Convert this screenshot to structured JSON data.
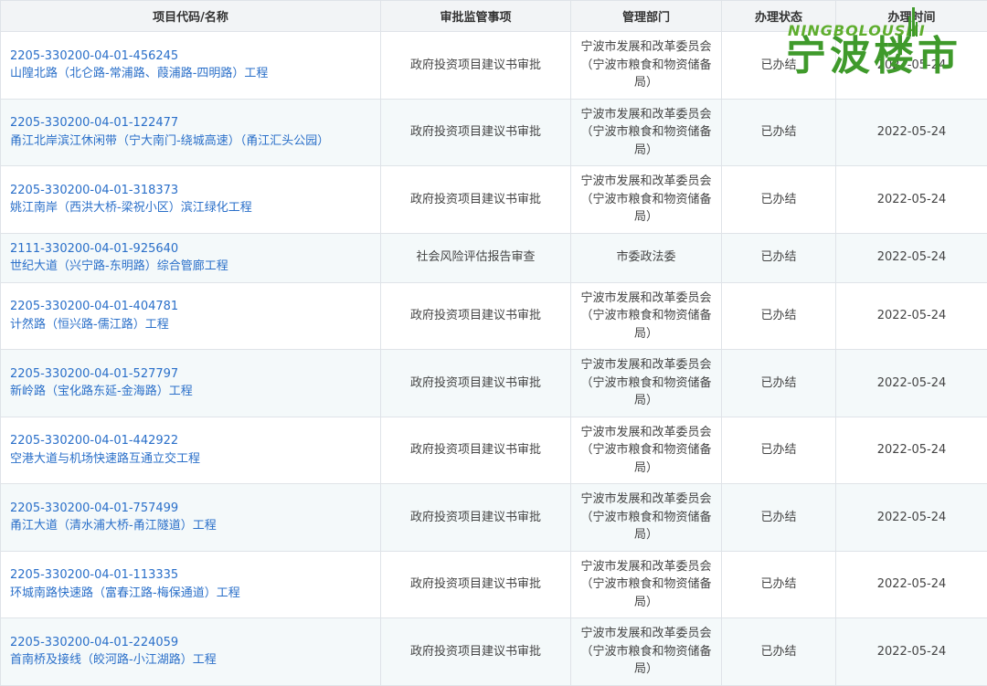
{
  "table": {
    "headers": [
      "项目代码/名称",
      "审批监管事项",
      "管理部门",
      "办理状态",
      "办理时间"
    ],
    "rows": [
      {
        "code": "2205-330200-04-01-456245",
        "name": "山隍北路（北仑路-常浦路、葭浦路-四明路）工程",
        "matter": "政府投资项目建议书审批",
        "dept": [
          "宁波市发展和改革委员会",
          "（宁波市粮食和物资储备",
          "局）"
        ],
        "status": "已办结",
        "date": "2022-05-24"
      },
      {
        "code": "2205-330200-04-01-122477",
        "name": "甬江北岸滨江休闲带（宁大南门-绕城高速）（甬江汇头公园）",
        "matter": "政府投资项目建议书审批",
        "dept": [
          "宁波市发展和改革委员会",
          "（宁波市粮食和物资储备",
          "局）"
        ],
        "status": "已办结",
        "date": "2022-05-24"
      },
      {
        "code": "2205-330200-04-01-318373",
        "name": "姚江南岸（西洪大桥-梁祝小区）滨江绿化工程",
        "matter": "政府投资项目建议书审批",
        "dept": [
          "宁波市发展和改革委员会",
          "（宁波市粮食和物资储备",
          "局）"
        ],
        "status": "已办结",
        "date": "2022-05-24"
      },
      {
        "code": "2111-330200-04-01-925640",
        "name": "世纪大道（兴宁路-东明路）综合管廊工程",
        "matter": "社会风险评估报告审查",
        "dept": [
          "市委政法委"
        ],
        "status": "已办结",
        "date": "2022-05-24"
      },
      {
        "code": "2205-330200-04-01-404781",
        "name": "计然路（恒兴路-儒江路）工程",
        "matter": "政府投资项目建议书审批",
        "dept": [
          "宁波市发展和改革委员会",
          "（宁波市粮食和物资储备",
          "局）"
        ],
        "status": "已办结",
        "date": "2022-05-24"
      },
      {
        "code": "2205-330200-04-01-527797",
        "name": "新岭路（宝化路东延-金海路）工程",
        "matter": "政府投资项目建议书审批",
        "dept": [
          "宁波市发展和改革委员会",
          "（宁波市粮食和物资储备",
          "局）"
        ],
        "status": "已办结",
        "date": "2022-05-24"
      },
      {
        "code": "2205-330200-04-01-442922",
        "name": "空港大道与机场快速路互通立交工程",
        "matter": "政府投资项目建议书审批",
        "dept": [
          "宁波市发展和改革委员会",
          "（宁波市粮食和物资储备",
          "局）"
        ],
        "status": "已办结",
        "date": "2022-05-24"
      },
      {
        "code": "2205-330200-04-01-757499",
        "name": "甬江大道（清水浦大桥-甬江隧道）工程",
        "matter": "政府投资项目建议书审批",
        "dept": [
          "宁波市发展和改革委员会",
          "（宁波市粮食和物资储备",
          "局）"
        ],
        "status": "已办结",
        "date": "2022-05-24"
      },
      {
        "code": "2205-330200-04-01-113335",
        "name": "环城南路快速路（富春江路-梅保通道）工程",
        "matter": "政府投资项目建议书审批",
        "dept": [
          "宁波市发展和改革委员会",
          "（宁波市粮食和物资储备",
          "局）"
        ],
        "status": "已办结",
        "date": "2022-05-24"
      },
      {
        "code": "2205-330200-04-01-224059",
        "name": "首南桥及接线（皎河路-小江湖路）工程",
        "matter": "政府投资项目建议书审批",
        "dept": [
          "宁波市发展和改革委员会",
          "（宁波市粮食和物资储备",
          "局）"
        ],
        "status": "已办结",
        "date": "2022-05-24"
      }
    ]
  },
  "watermark": {
    "latin": "NINGBOLOUSHI",
    "cjk": "宁波楼市",
    "color": "#3f9a2b"
  },
  "colors": {
    "link": "#2a6fc9",
    "header_bg": "#f2f4f6",
    "stripe_bg": "#f4f9fa",
    "border": "#dfe3e8"
  }
}
